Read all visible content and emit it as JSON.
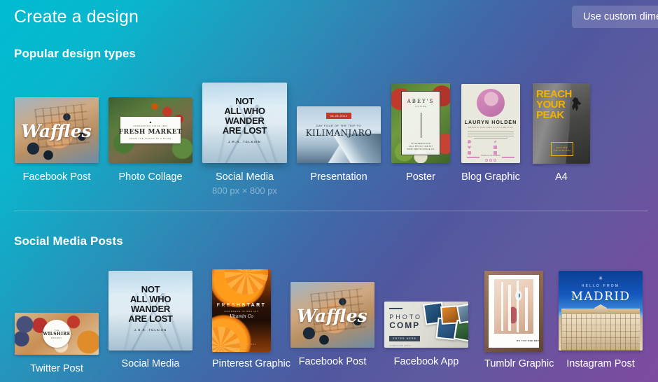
{
  "header": {
    "title": "Create a design",
    "custom_dimensions_button": "Use custom dimensions"
  },
  "theme": {
    "gradient_start": "#00bcd1",
    "gradient_mid": "#4069a8",
    "gradient_end": "#7d4ba0",
    "label_color": "#ffffff"
  },
  "sections": [
    {
      "heading": "Popular design types",
      "cards": [
        {
          "label": "Facebook Post",
          "dimensions": ""
        },
        {
          "label": "Photo Collage",
          "dimensions": ""
        },
        {
          "label": "Social Media",
          "dimensions": "800 px × 800 px"
        },
        {
          "label": "Presentation",
          "dimensions": ""
        },
        {
          "label": "Poster",
          "dimensions": ""
        },
        {
          "label": "Blog Graphic",
          "dimensions": ""
        },
        {
          "label": "A4",
          "dimensions": ""
        }
      ]
    },
    {
      "heading": "Social Media Posts",
      "cards": [
        {
          "label": "Twitter Post",
          "dimensions": ""
        },
        {
          "label": "Social Media",
          "dimensions": ""
        },
        {
          "label": "Pinterest Graphic",
          "dimensions": ""
        },
        {
          "label": "Facebook Post",
          "dimensions": ""
        },
        {
          "label": "Facebook App",
          "dimensions": ""
        },
        {
          "label": "Tumblr Graphic",
          "dimensions": ""
        },
        {
          "label": "Instagram Post",
          "dimensions": ""
        }
      ]
    }
  ],
  "artwork": {
    "waffles": {
      "word": "Waffles"
    },
    "fresh_market": {
      "eyebrow": "HARVESTING SINCE 1863",
      "title": "FRESH MARKET",
      "footer": "FROM THE FIELDS TO A PLATE"
    },
    "tolkien": {
      "line1": "NOT",
      "line2": "ALL WHO",
      "line3": "WANDER",
      "line4": "ARE LOST",
      "attrib": "J.R.R. TOLKIEN"
    },
    "kilimanjaro": {
      "date": "05.28.2014",
      "eyebrow": "DAY FOUR OF THE TRIP TO",
      "title": "KILIMANJARO"
    },
    "abeys": {
      "brand": "ABEY'S",
      "tagline": "CUISINE",
      "footer_line1": "TO RESERVATION",
      "footer_line2": "CALL 555 017 448 097",
      "footer_line3": "WWW.ABEYSCUISINE.CO"
    },
    "lauryn": {
      "name": "LAURYN HOLDEN",
      "subtitle": "GRAPHIC DESIGNER & ART DIRECTOR",
      "footer": "Thanks for the feedback"
    },
    "reach_peak": {
      "title": "REACH\nYOUR\nPEAK",
      "box_line1": "EXPLORE",
      "box_line2": "THE OUTDOORS"
    },
    "wilshire": {
      "top": "THE",
      "main": "WILSHIRE",
      "bottom": "BAKERY"
    },
    "fresh_start": {
      "title_light": "FRESH",
      "title_bold": "START",
      "subtitle": "GOODNESS IN ONE HIT",
      "script": "Vitamin Co",
      "footer": "VITAMINSDRINK.NET"
    },
    "photo_comp": {
      "line1": "PHOTO",
      "line2": "COMP",
      "badge": "ENTER HERE",
      "terms": "CONDITIONS APPLY"
    },
    "tumblr_face": {
      "caption": "DO YOU SEE ME?"
    },
    "madrid": {
      "star": "✳",
      "hello": "HELLO FROM",
      "title": "MADRID"
    }
  }
}
